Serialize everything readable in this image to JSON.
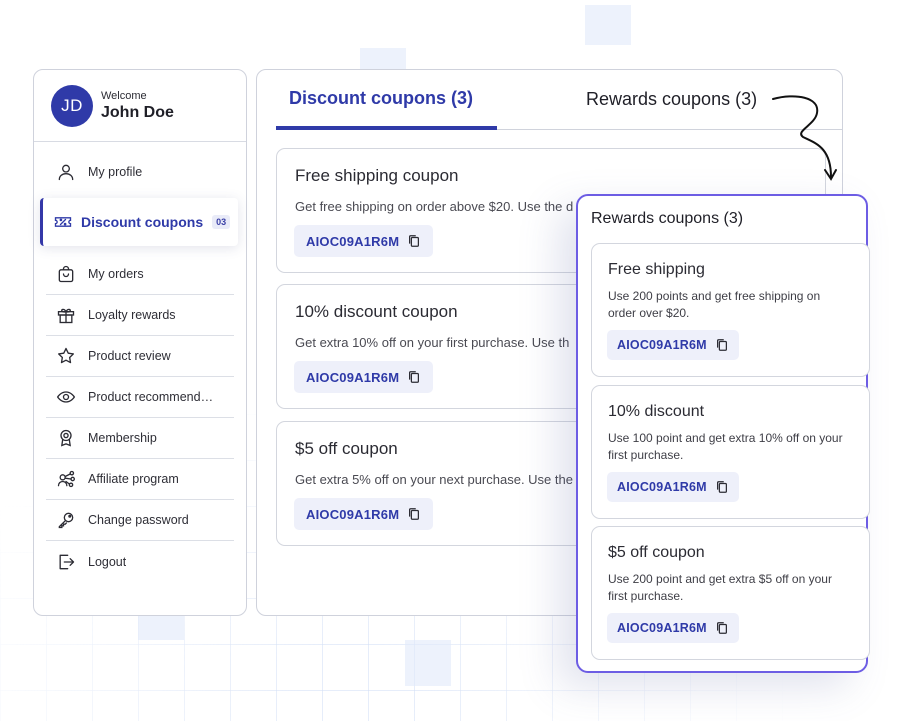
{
  "user": {
    "initials": "JD",
    "welcome": "Welcome",
    "name": "John Doe"
  },
  "sidebar": {
    "items": [
      {
        "label": "My profile",
        "icon": "user-icon"
      },
      {
        "label": "Discount coupons",
        "icon": "ticket-icon",
        "badge": "03",
        "active": true
      },
      {
        "label": "My orders",
        "icon": "shopping-bag-icon"
      },
      {
        "label": "Loyalty rewards",
        "icon": "gift-icon"
      },
      {
        "label": "Product review",
        "icon": "star-icon"
      },
      {
        "label": "Product recommendati...",
        "icon": "eye-icon"
      },
      {
        "label": "Membership",
        "icon": "badge-icon"
      },
      {
        "label": "Affiliate program",
        "icon": "network-icon"
      },
      {
        "label": "Change password",
        "icon": "key-icon"
      },
      {
        "label": "Logout",
        "icon": "logout-icon"
      }
    ]
  },
  "tabs": {
    "discount": "Discount coupons (3)",
    "rewards": "Rewards coupons (3)"
  },
  "discount_coupons": [
    {
      "title": "Free shipping coupon",
      "desc": "Get free shipping on order above $20. Use the d",
      "code": "AIOC09A1R6M"
    },
    {
      "title": "10% discount coupon",
      "desc": "Get extra 10% off on your first purchase. Use th",
      "code": "AIOC09A1R6M"
    },
    {
      "title": "$5 off coupon",
      "desc": "Get extra 5% off on your next purchase. Use the",
      "code": "AIOC09A1R6M"
    }
  ],
  "rewards_popup": {
    "title": "Rewards coupons (3)",
    "coupons": [
      {
        "title": "Free shipping",
        "desc": "Use 200 points and get free shipping on order over $20.",
        "code": "AIOC09A1R6M"
      },
      {
        "title": "10% discount",
        "desc": "Use 100 point and get extra 10% off on your first purchase.",
        "code": "AIOC09A1R6M"
      },
      {
        "title": "$5 off coupon",
        "desc": "Use 200 point and get extra $5 off on your first purchase.",
        "code": "AIOC09A1R6M"
      }
    ]
  },
  "colors": {
    "accent": "#2f3aa8",
    "popup_border": "#6d5de4",
    "chip_bg": "#eef0fa"
  }
}
